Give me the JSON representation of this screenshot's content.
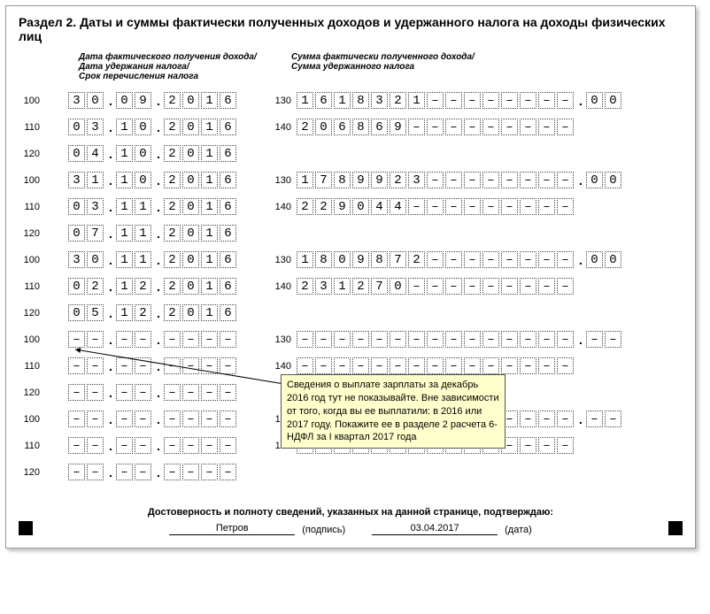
{
  "title": "Раздел 2. Даты и суммы фактически полученных доходов и удержанного налога на доходы физических лиц",
  "header_left": "Дата фактического получения дохода/\nДата удержания налога/\nСрок перечисления налога",
  "header_right": "Сумма фактически полученного дохода/\nСумма удержанного налога",
  "dash": "–",
  "groups": [
    {
      "r100": {
        "d": "30",
        "m": "09",
        "y": "2016"
      },
      "r110": {
        "d": "03",
        "m": "10",
        "y": "2016"
      },
      "r120": {
        "d": "04",
        "m": "10",
        "y": "2016"
      },
      "r130": {
        "int": "1618321––––––––",
        "dec": "00"
      },
      "r140": "206869–––––––––"
    },
    {
      "r100": {
        "d": "31",
        "m": "10",
        "y": "2016"
      },
      "r110": {
        "d": "03",
        "m": "11",
        "y": "2016"
      },
      "r120": {
        "d": "07",
        "m": "11",
        "y": "2016"
      },
      "r130": {
        "int": "1789923––––––––",
        "dec": "00"
      },
      "r140": "229044–––––––––"
    },
    {
      "r100": {
        "d": "30",
        "m": "11",
        "y": "2016"
      },
      "r110": {
        "d": "02",
        "m": "12",
        "y": "2016"
      },
      "r120": {
        "d": "05",
        "m": "12",
        "y": "2016"
      },
      "r130": {
        "int": "1809872––––––––",
        "dec": "00"
      },
      "r140": "231270–––––––––"
    },
    {
      "r100": {
        "d": "––",
        "m": "––",
        "y": "––––"
      },
      "r110": {
        "d": "––",
        "m": "––",
        "y": "––––"
      },
      "r120": {
        "d": "––",
        "m": "––",
        "y": "––––"
      },
      "r130": {
        "int": "–––––––––––––––",
        "dec": "––"
      },
      "r140": "–––––––––––––––"
    },
    {
      "r100": {
        "d": "––",
        "m": "––",
        "y": "––––"
      },
      "r110": {
        "d": "––",
        "m": "––",
        "y": "––––"
      },
      "r120": {
        "d": "––",
        "m": "––",
        "y": "––––"
      },
      "r130": {
        "int": "–––––––––––––––",
        "dec": "––"
      },
      "r140": "–––––––––––––––"
    }
  ],
  "tooltip": "Сведения о выплате зарплаты за декабрь 2016 год тут не показывайте. Вне зависимости от того, когда вы ее выплатили: в 2016 или 2017 году. Покажите ее в разделе 2 расчета 6-НДФЛ за I квартал 2017 года",
  "footer_title": "Достоверность и полноту сведений, указанных на данной странице, подтверждаю:",
  "sign_name": "Петров",
  "sign_label": "(подпись)",
  "sign_date": "03.04.2017",
  "date_label": "(дата)"
}
